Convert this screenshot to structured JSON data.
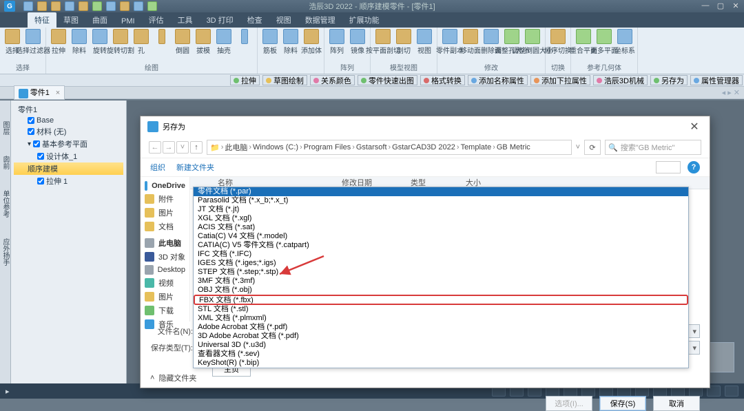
{
  "title": "浩辰3D 2022 - 顺序建模零件 - [零件1]",
  "ribbon_tabs": [
    "特征",
    "草图",
    "曲面",
    "PMI",
    "评估",
    "工具",
    "3D 打印",
    "检查",
    "视图",
    "数据管理",
    "扩展功能"
  ],
  "ribbon_groups": [
    {
      "title": "选择",
      "btns": [
        {
          "l": "选择"
        },
        {
          "l": "选择过滤器"
        }
      ]
    },
    {
      "title": "绘图",
      "btns": [
        {
          "l": "拉伸"
        },
        {
          "l": "除料"
        },
        {
          "l": "旋转"
        },
        {
          "l": "旋转切割"
        },
        {
          "l": "孔"
        },
        {
          "l": "",
          "s": 1
        },
        {
          "l": "倒圆"
        },
        {
          "l": "拔模"
        },
        {
          "l": "抽売"
        },
        {
          "l": "",
          "s": 1
        }
      ]
    },
    {
      "title": "",
      "btns": [
        {
          "l": "筋板"
        },
        {
          "l": "除料"
        },
        {
          "l": "添加体"
        }
      ]
    },
    {
      "title": "阵列",
      "btns": [
        {
          "l": "阵列"
        },
        {
          "l": "镜像"
        }
      ]
    },
    {
      "title": "模型视图",
      "btns": [
        {
          "l": "按平面剖切"
        },
        {
          "l": "剖切"
        },
        {
          "l": "视图"
        }
      ]
    },
    {
      "title": "修改",
      "btns": [
        {
          "l": "零件副本"
        },
        {
          "l": "移动面"
        },
        {
          "l": "删除面"
        },
        {
          "l": "调整孔大小"
        },
        {
          "l": "调整倒圆大小"
        }
      ]
    },
    {
      "title": "切换",
      "btns": [
        {
          "l": "顺序切换"
        }
      ]
    },
    {
      "title": "参考几何体",
      "btns": [
        {
          "l": "重合平面"
        },
        {
          "l": "更多平面"
        },
        {
          "l": "坐标系"
        }
      ]
    }
  ],
  "strip_chips": [
    {
      "c": "bg-green",
      "t": "拉伸"
    },
    {
      "c": "bg-yellow",
      "t": "草图绘制"
    },
    {
      "c": "bg-pink",
      "t": "关系颜色"
    },
    {
      "c": "bg-green",
      "t": "零件快速出图"
    },
    {
      "c": "bg-red",
      "t": "格式转换"
    },
    {
      "c": "bg-blue",
      "t": "添加名称属性"
    },
    {
      "c": "bg-orange",
      "t": "添加下拉属性"
    },
    {
      "c": "bg-pink",
      "t": "浩辰3D机械"
    },
    {
      "c": "bg-green",
      "t": "另存为"
    },
    {
      "c": "bg-blue",
      "t": "属性管理器"
    }
  ],
  "doc_tab": {
    "label": "零件1",
    "close": "×"
  },
  "tree": [
    {
      "l": "零件1",
      "cls": ""
    },
    {
      "l": "Base",
      "cls": "indent1",
      "chk": true
    },
    {
      "l": "材料 (无)",
      "cls": "indent1",
      "chk": true
    },
    {
      "l": "基本参考平面",
      "cls": "indent1",
      "chk": true,
      "dd": true
    },
    {
      "l": "设计体_1",
      "cls": "indent2",
      "chk": true
    },
    {
      "l": "顺序建模",
      "cls": "indent1 sel"
    },
    {
      "l": "拉伸 1",
      "cls": "indent2",
      "chk": true
    }
  ],
  "side_palettes": [
    "图层",
    "囱前",
    "单位参考",
    "应外扬手"
  ],
  "dialog": {
    "title": "另存为",
    "breadcrumb": [
      "此电脑",
      "Windows (C:)",
      "Program Files",
      "Gstarsoft",
      "GstarCAD3D 2022",
      "Template",
      "GB Metric"
    ],
    "search_ph": "搜索\"GB Metric\"",
    "toolbar": {
      "organize": "组织",
      "newfolder": "新建文件夹"
    },
    "cols": {
      "name": "名称",
      "date": "修改日期",
      "type": "类型",
      "size": "大小"
    },
    "side_items": [
      {
        "c": "c-blue",
        "l": "OneDrive",
        "bold": true
      },
      {
        "c": "c-yellow",
        "l": "附件"
      },
      {
        "c": "c-yellow",
        "l": "图片"
      },
      {
        "c": "c-yellow",
        "l": "文档"
      },
      {
        "c": "",
        "l": ""
      },
      {
        "c": "c-gray",
        "l": "此电脑",
        "bold": true
      },
      {
        "c": "c-navy",
        "l": "3D 对象"
      },
      {
        "c": "c-gray",
        "l": "Desktop"
      },
      {
        "c": "c-teal",
        "l": "视频"
      },
      {
        "c": "c-yellow",
        "l": "图片"
      },
      {
        "c": "c-green",
        "l": "下载"
      },
      {
        "c": "c-blue",
        "l": "音乐"
      }
    ],
    "type_options": [
      {
        "l": "零件文档 (*.par)",
        "sel": true
      },
      {
        "l": "Parasolid 文档 (*.x_b;*.x_t)"
      },
      {
        "l": "JT 文档 (*.jt)"
      },
      {
        "l": "XGL 文档 (*.xgl)"
      },
      {
        "l": "ACIS 文档 (*.sat)"
      },
      {
        "l": "Catia(C) V4 文档 (*.model)"
      },
      {
        "l": "CATIA(C) V5 零件文档 (*.catpart)"
      },
      {
        "l": "IFC 文档 (*.IFC)"
      },
      {
        "l": "IGES 文档 (*.iges;*.igs)"
      },
      {
        "l": "STEP 文档 (*.step;*.stp)"
      },
      {
        "l": "3MF 文档 (*.3mf)"
      },
      {
        "l": "OBJ 文档 (*.obj)"
      },
      {
        "l": "FBX 文档 (*.fbx)",
        "hl": true
      },
      {
        "l": "STL 文档 (*.stl)"
      },
      {
        "l": "XML 文档 (*.plmxml)"
      },
      {
        "l": "Adobe Acrobat 文档 (*.pdf)"
      },
      {
        "l": "3D Adobe Acrobat 文档 (*.pdf)"
      },
      {
        "l": "Universal 3D (*.u3d)"
      },
      {
        "l": "查看器文档 (*.sev)"
      },
      {
        "l": "KeyShot(R) (*.bip)"
      }
    ],
    "fields": {
      "name_label": "文件名(N):",
      "type_label": "保存类型(T):",
      "type_value": "零件文档 (*.par)"
    },
    "homepage_btn": "主页",
    "expand": "隐藏文件夹",
    "options": "选项(I)...",
    "save": "保存(S)",
    "cancel": "取消"
  }
}
